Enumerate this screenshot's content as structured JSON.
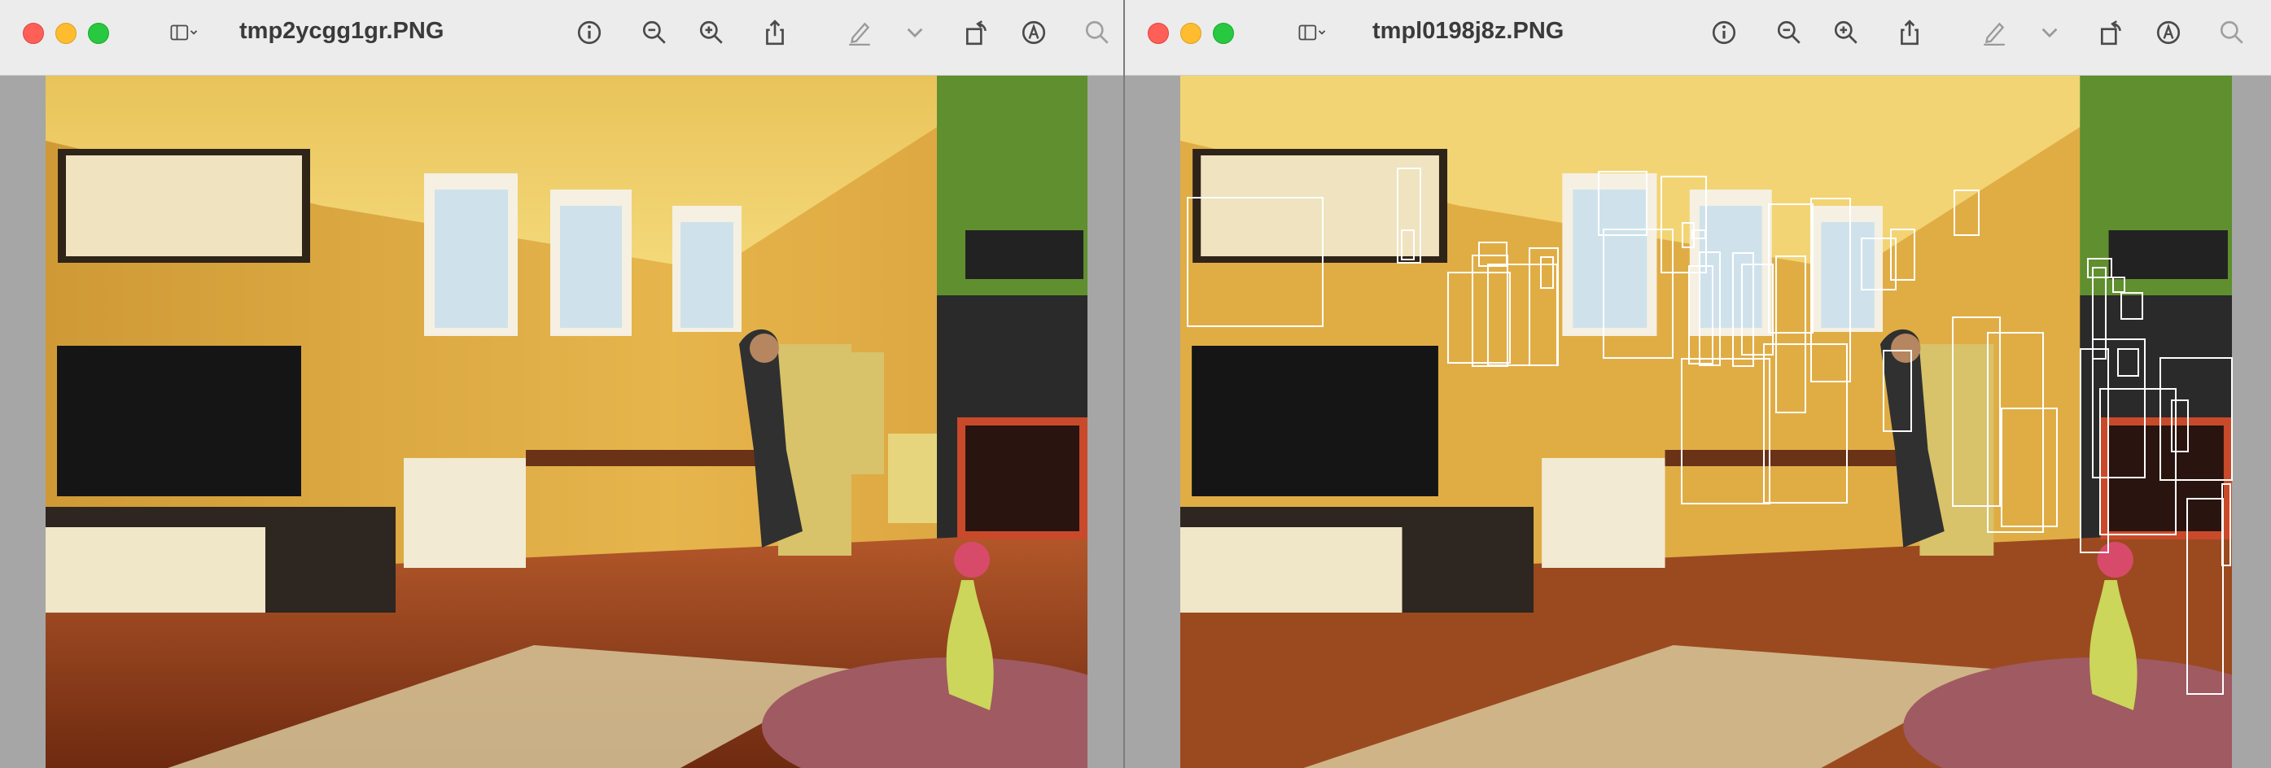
{
  "windows": [
    {
      "title": "tmp2ycgg1gr.PNG",
      "toolbar": [
        "sidebar-toggle",
        "info",
        "zoom-out",
        "zoom-in",
        "share",
        "markup",
        "more",
        "rotate",
        "annotate",
        "search"
      ]
    },
    {
      "title": "tmpl0198j8z.PNG",
      "toolbar": [
        "sidebar-toggle",
        "info",
        "zoom-out",
        "zoom-in",
        "share",
        "markup",
        "more",
        "rotate",
        "annotate",
        "search"
      ]
    }
  ],
  "photo": {
    "description_colors": {
      "wall": "#e3b24a",
      "ceiling": "#f0cf6a",
      "green_wall": "#5f8f2e",
      "floor": "#a8471c",
      "tv": "#1a1a1a"
    }
  }
}
